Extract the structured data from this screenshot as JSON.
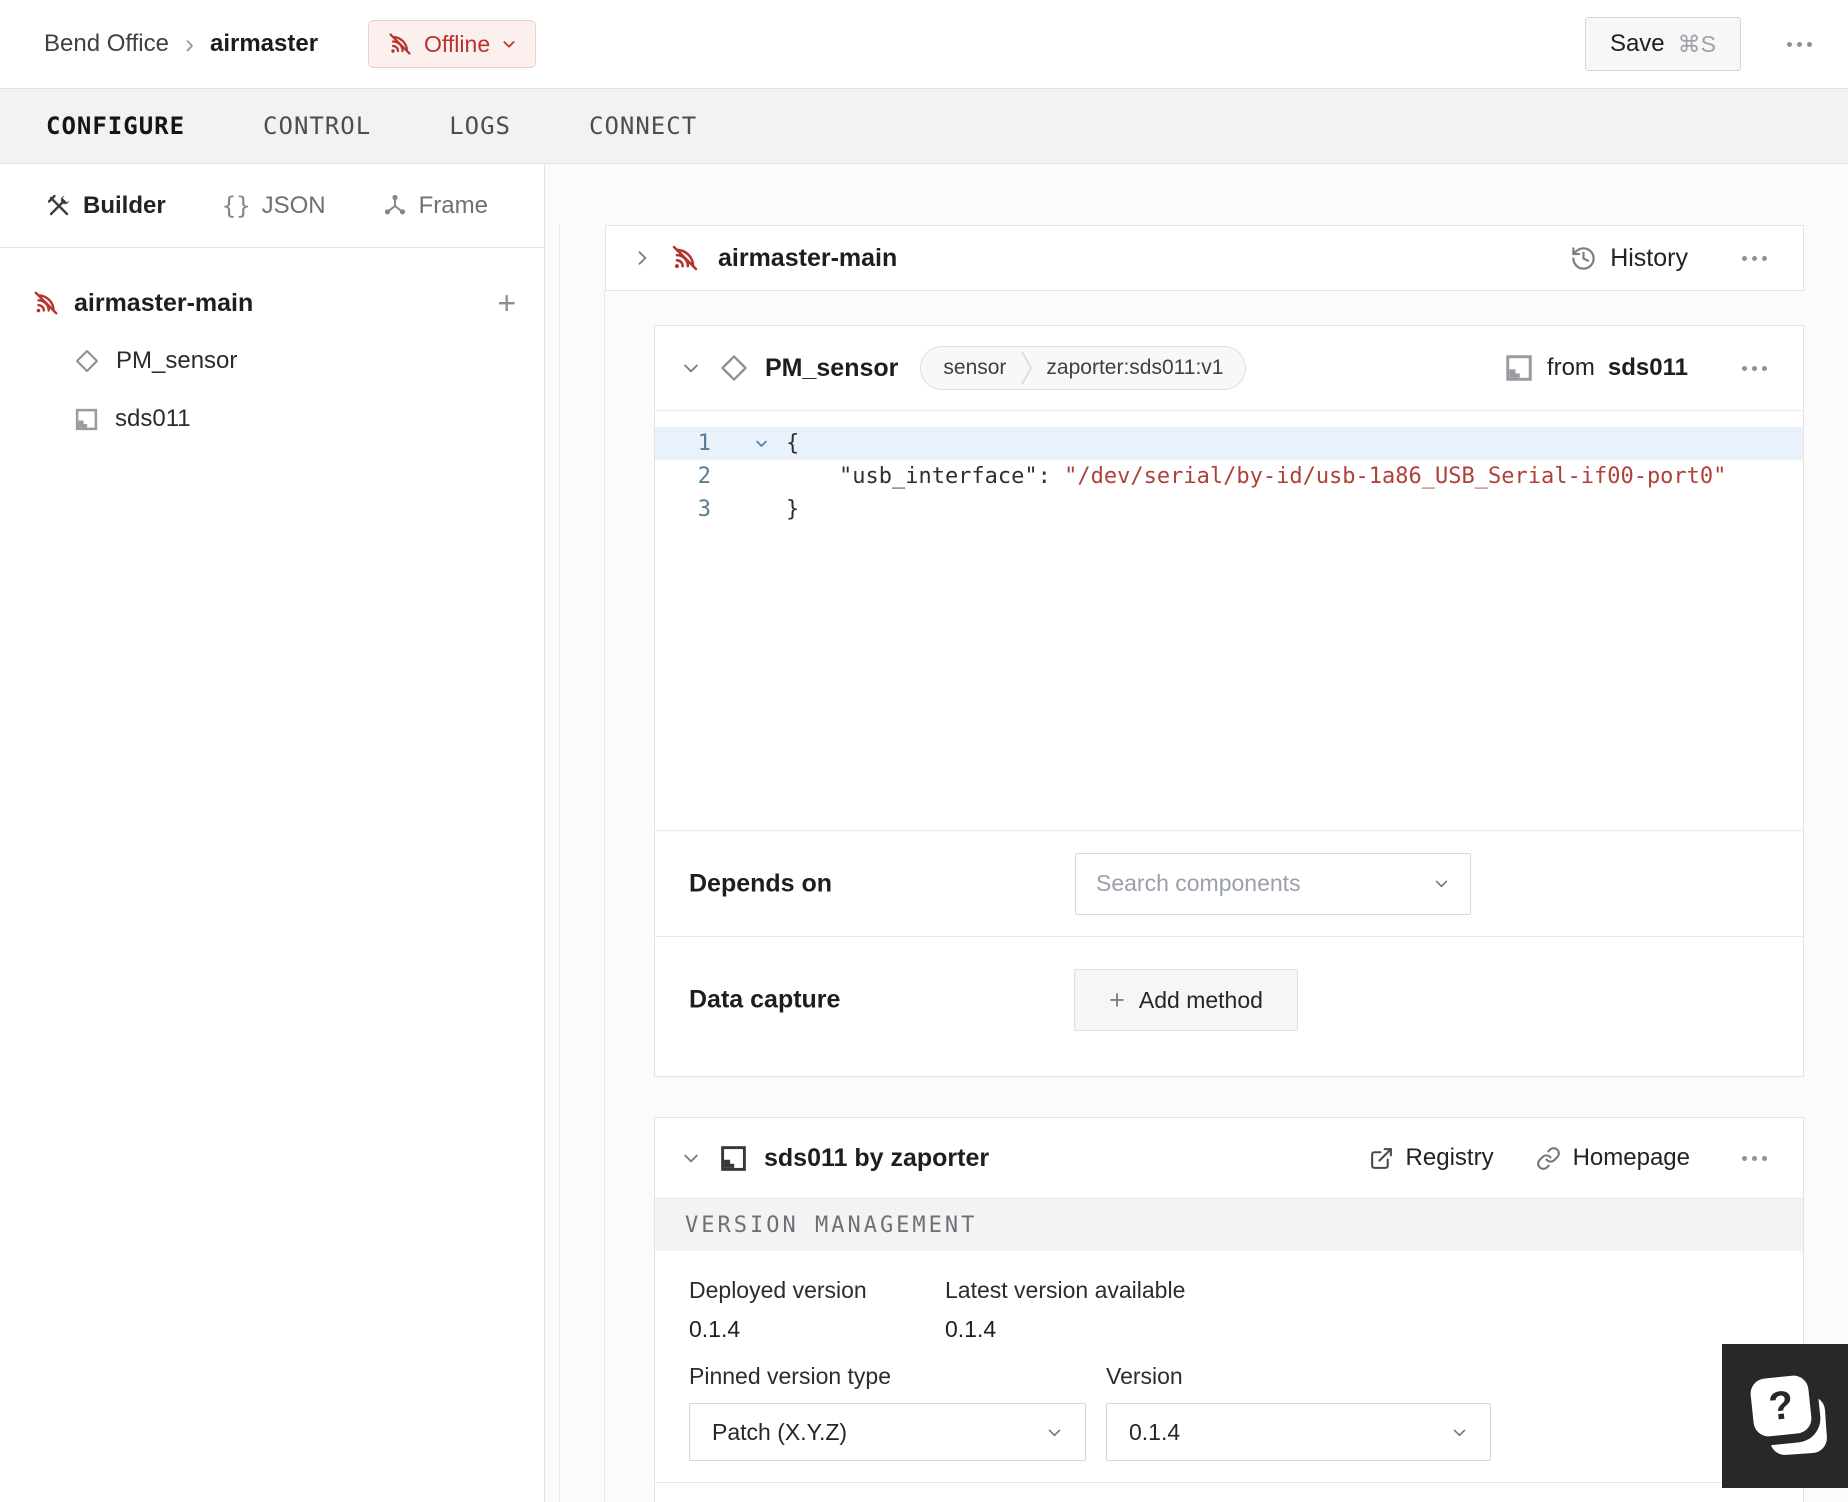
{
  "colors": {
    "offline_red": "#b5342f",
    "offline_badge_bg": "#fcf0ee",
    "code_string_red": "#b0403a",
    "line_number_blue": "#557d98",
    "line_highlight": "#e9f1fb",
    "tabbar_bg": "#f2f2f3",
    "text_dark": "#1c1c1e"
  },
  "icons": {
    "breadcrumb_separator": "›",
    "plus": "+",
    "json_glyph": "{}",
    "help_glyph": "?"
  },
  "topbar": {
    "breadcrumb_parent": "Bend Office",
    "breadcrumb_current": "airmaster",
    "status_label": "Offline",
    "save_label": "Save",
    "save_shortcut": "⌘S"
  },
  "tabs": {
    "items": [
      {
        "label": "CONFIGURE",
        "active": true
      },
      {
        "label": "CONTROL",
        "active": false
      },
      {
        "label": "LOGS",
        "active": false
      },
      {
        "label": "CONNECT",
        "active": false
      }
    ]
  },
  "sidebar": {
    "modes": [
      {
        "label": "Builder"
      },
      {
        "label": "JSON"
      },
      {
        "label": "Frame"
      }
    ],
    "tree": {
      "part_label": "airmaster-main",
      "children": [
        {
          "label": "PM_sensor"
        },
        {
          "label": "sds011"
        }
      ]
    }
  },
  "part_card": {
    "title": "airmaster-main",
    "history_label": "History"
  },
  "component_card": {
    "title": "PM_sensor",
    "type_badge": "sensor",
    "model_badge": "zaporter:sds011:v1",
    "from_prefix": "from",
    "from_name": "sds011",
    "code": {
      "line_numbers": [
        "1",
        "2",
        "3"
      ],
      "line1": "{",
      "line2_key": "    \"usb_interface\": ",
      "line2_value": "\"/dev/serial/by-id/usb-1a86_USB_Serial-if00-port0\"",
      "line3": "}"
    },
    "depends_on": {
      "label": "Depends on",
      "placeholder": "Search components"
    },
    "data_capture": {
      "label": "Data capture",
      "button_label": "Add method"
    }
  },
  "module_card": {
    "title": "sds011 by zaporter",
    "registry_label": "Registry",
    "homepage_label": "Homepage",
    "section_title": "VERSION MANAGEMENT",
    "deployed_label": "Deployed version",
    "deployed_value": "0.1.4",
    "latest_label": "Latest version available",
    "latest_value": "0.1.4",
    "pinned_label": "Pinned version type",
    "pinned_value": "Patch (X.Y.Z)",
    "version_label": "Version",
    "version_value": "0.1.4"
  },
  "help": {
    "glyph": "?"
  }
}
